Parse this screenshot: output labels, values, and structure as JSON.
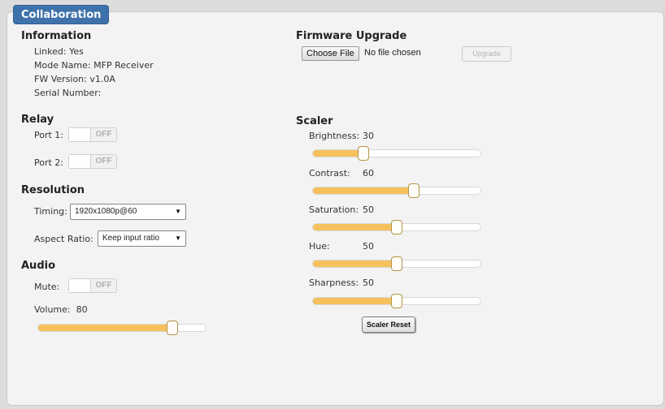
{
  "tab": {
    "label": "Collaboration"
  },
  "information": {
    "heading": "Information",
    "linked": "Linked: Yes",
    "mode_name": "Mode Name: MFP Receiver",
    "fw_version": "FW Version: v1.0A",
    "serial_number": "Serial Number:"
  },
  "relay": {
    "heading": "Relay",
    "port1_label": "Port 1:",
    "port1_state": "OFF",
    "port2_label": "Port 2:",
    "port2_state": "OFF"
  },
  "resolution": {
    "heading": "Resolution",
    "timing_label": "Timing:",
    "timing_value": "1920x1080p@60",
    "aspect_label": "Aspect Ratio:",
    "aspect_value": "Keep input ratio",
    "dropdown_arrow": "▼"
  },
  "audio": {
    "heading": "Audio",
    "mute_label": "Mute:",
    "mute_state": "OFF",
    "volume_label": "Volume:",
    "volume_value": "80",
    "volume_level": 80
  },
  "firmware": {
    "heading": "Firmware Upgrade",
    "choose_file": "Choose File",
    "no_file": "No file chosen",
    "upgrade": "Upgrade"
  },
  "scaler": {
    "heading": "Scaler",
    "brightness_label": "Brightness:",
    "brightness_value": "30",
    "brightness_level": 30,
    "contrast_label": "Contrast:",
    "contrast_value": "60",
    "contrast_level": 60,
    "saturation_label": "Saturation:",
    "saturation_value": "50",
    "saturation_level": 50,
    "hue_label": "Hue:",
    "hue_value": "50",
    "hue_level": 50,
    "sharpness_label": "Sharpness:",
    "sharpness_value": "50",
    "sharpness_level": 50,
    "reset": "Scaler Reset"
  },
  "colors": {
    "tab_bg": "#3f72ab",
    "slider_fill": "#f6c15c"
  }
}
